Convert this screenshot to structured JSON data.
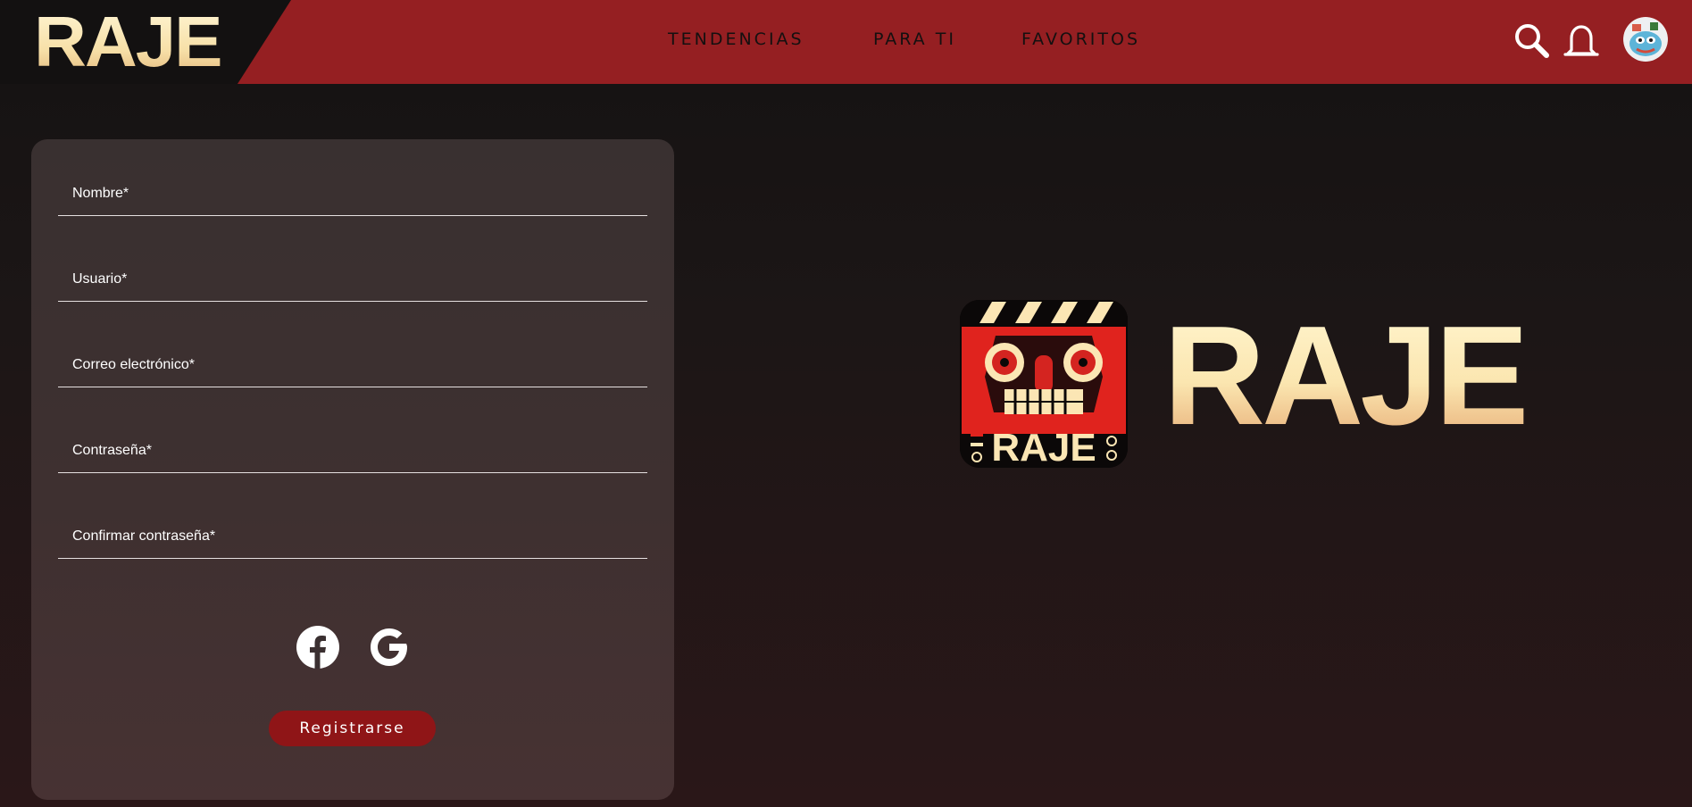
{
  "header": {
    "logo": "RAJE",
    "nav": [
      {
        "label": "TENDENCIAS"
      },
      {
        "label": "PARA TI"
      },
      {
        "label": "FAVORITOS"
      }
    ],
    "icons": [
      "search-icon",
      "notifications-icon",
      "user-avatar"
    ]
  },
  "form": {
    "fields": [
      {
        "label": "Nombre*"
      },
      {
        "label": "Usuario*"
      },
      {
        "label": "Correo electrónico*"
      },
      {
        "label": "Contraseña*"
      },
      {
        "label": "Confirmar contraseña*"
      }
    ],
    "social": [
      "facebook-icon",
      "google-icon"
    ],
    "submit_label": "Registrarse"
  },
  "hero": {
    "wordmark": "RAJE",
    "icon_text": "RAJE"
  },
  "colors": {
    "header_red": "#951f22",
    "button_red": "#8f1517",
    "logo_cream": "#fbe6b4",
    "card_bg": "#3c3030",
    "page_bg": "#171313"
  }
}
